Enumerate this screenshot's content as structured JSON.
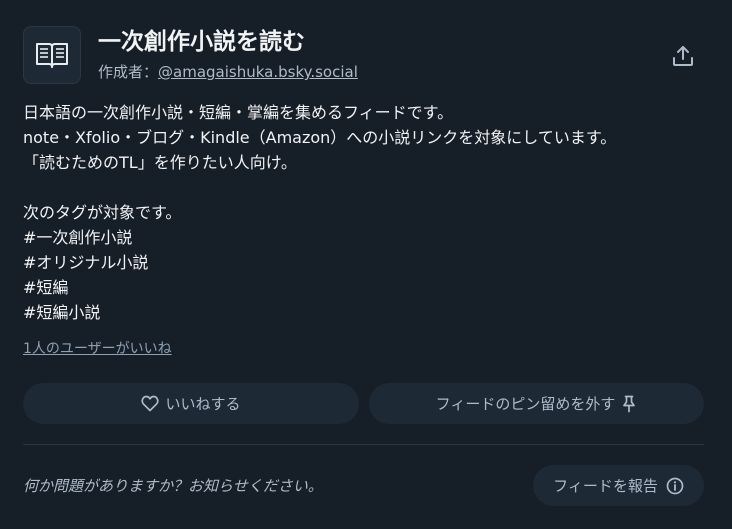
{
  "feed": {
    "title": "一次創作小説を読む",
    "creator_prefix": "作成者：",
    "creator_handle": "@amagaishuka.bsky.social",
    "description_lines": [
      "日本語の一次創作小説・短編・掌編を集めるフィードです。",
      "note・Xfolio・ブログ・Kindle（Amazon）への小説リンクを対象にしています。",
      "「読むためのTL」を作りたい人向け。",
      "",
      "次のタグが対象です。",
      "#一次創作小説",
      "#オリジナル小説",
      "#短編",
      "#短編小説"
    ],
    "likes_text": "1人のユーザーがいいね"
  },
  "actions": {
    "like_label": "いいねする",
    "unpin_label": "フィードのピン留めを外す"
  },
  "footer": {
    "report_prompt": "何か問題がありますか？お知らせください。",
    "report_label": "フィードを報告"
  },
  "icons": {
    "avatar": "book-icon",
    "share": "share-icon",
    "like": "heart-icon",
    "unpin": "pin-icon",
    "report": "info-icon"
  },
  "colors": {
    "background": "#161e27",
    "button_bg": "#1e2936",
    "text_primary": "#f1f3f5",
    "text_secondary": "#aebbc9"
  }
}
